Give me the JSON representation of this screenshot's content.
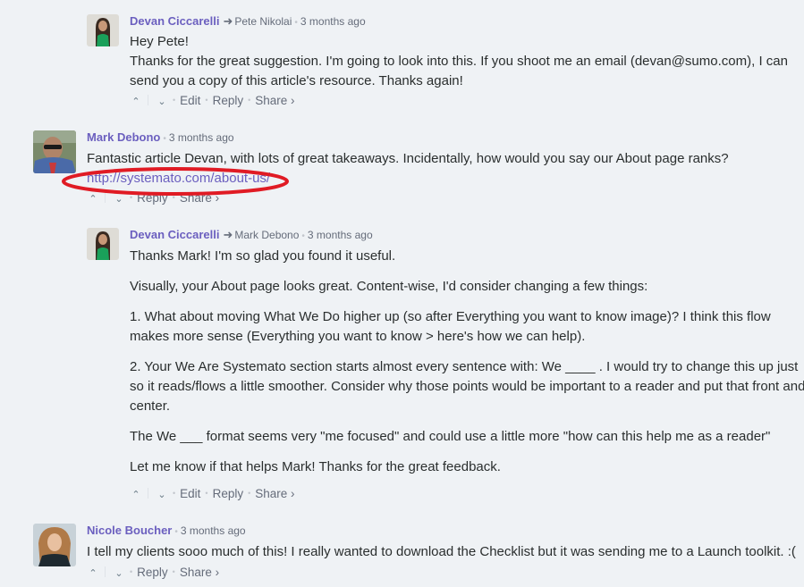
{
  "comments": [
    {
      "author": "Devan Ciccarelli",
      "reply_to": "Pete Nikolai",
      "time": "3 months ago",
      "paragraphs": [
        "Hey Pete!",
        "Thanks for the great suggestion. I'm going to look into this. If you shoot me an email (devan@sumo.com), I can send you a copy of this article's resource. Thanks again!"
      ],
      "actions": {
        "edit": "Edit",
        "reply": "Reply",
        "share": "Share ›"
      }
    },
    {
      "author": "Mark Debono",
      "time": "3 months ago",
      "text": "Fantastic article Devan, with lots of great takeaways. Incidentally, how would you say our About page ranks?",
      "link": "http://systemato.com/about-us/",
      "actions": {
        "reply": "Reply",
        "share": "Share ›"
      }
    },
    {
      "author": "Devan Ciccarelli",
      "reply_to": "Mark Debono",
      "time": "3 months ago",
      "paragraphs": [
        "Thanks Mark! I'm so glad you found it useful.",
        "Visually, your About page looks great. Content-wise, I'd consider changing a few things:",
        "1. What about moving What We Do higher up (so after Everything you want to know image)? I think this flow makes more sense (Everything you want to know > here's how we can help).",
        "2. Your We Are Systemato section starts almost every sentence with: We ____ . I would try to change this up just so it reads/flows a little smoother. Consider why those points would be important to a reader and put that front and center.",
        "The We ___ format seems very \"me focused\" and could use a little more \"how can this help me as a reader\"",
        "Let me know if that helps Mark! Thanks for the great feedback."
      ],
      "actions": {
        "edit": "Edit",
        "reply": "Reply",
        "share": "Share ›"
      }
    },
    {
      "author": "Nicole Boucher",
      "time": "3 months ago",
      "text": "I tell my clients sooo much of this! I really wanted to download the Checklist but it was sending me to a Launch toolkit. :(",
      "actions": {
        "reply": "Reply",
        "share": "Share ›"
      }
    }
  ],
  "icons": {
    "upvote": "⌃",
    "downvote": "⌄",
    "reply_arrow": "➜",
    "bullet": "•"
  },
  "colors": {
    "author": "#6b5fbf",
    "annotation": "#e01b24",
    "background": "#eff2f5"
  }
}
